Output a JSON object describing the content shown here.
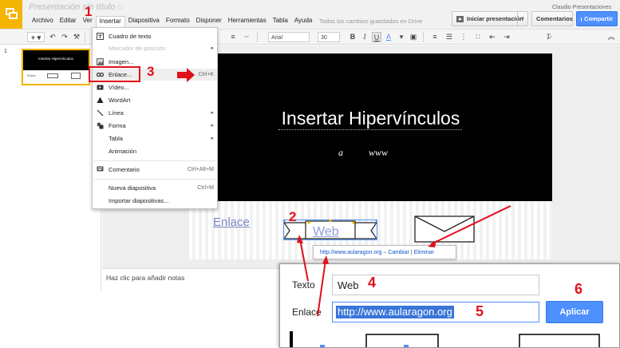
{
  "header": {
    "doc_title": "Presentación sin título",
    "user": "Claudio Presentaciones",
    "save_status": "Todos los cambios guardados en Drive",
    "present_label": "Iniciar presentación",
    "comments_label": "Comentarios",
    "share_label": "Compartir"
  },
  "menubar": [
    "Archivo",
    "Editar",
    "Ver",
    "Insertar",
    "Diapositiva",
    "Formato",
    "Disponer",
    "Herramientas",
    "Tabla",
    "Ayuda"
  ],
  "toolbar": {
    "font": "Arial",
    "size": "30",
    "bold": "B",
    "italic": "I",
    "underline": "U",
    "textcolor": "A"
  },
  "insert_menu": [
    {
      "label": "Cuadro de texto",
      "shortcut": "",
      "icon": "textbox-icon"
    },
    {
      "label": "Marcador de posición",
      "shortcut": "",
      "icon": ""
    },
    {
      "label": "Imagen...",
      "shortcut": "",
      "icon": "image-icon"
    },
    {
      "label": "Enlace...",
      "shortcut": "Ctrl+K",
      "icon": "link-icon"
    },
    {
      "label": "Vídeo...",
      "shortcut": "",
      "icon": "video-icon"
    },
    {
      "label": "WordArt",
      "shortcut": "",
      "icon": "wordart-icon"
    },
    {
      "label": "Línea",
      "shortcut": "",
      "icon": "line-icon"
    },
    {
      "label": "Forma",
      "shortcut": "",
      "icon": "shape-icon"
    },
    {
      "label": "Tabla",
      "shortcut": "",
      "icon": ""
    },
    {
      "label": "Animación",
      "shortcut": "",
      "icon": ""
    },
    {
      "label": "Comentario",
      "shortcut": "Ctrl+Alt+M",
      "icon": "comment-icon"
    },
    {
      "label": "Nueva diapositiva",
      "shortcut": "Ctrl+M",
      "icon": ""
    },
    {
      "label": "Importar diapositivas...",
      "shortcut": "",
      "icon": ""
    }
  ],
  "filmstrip": {
    "slide_number": "1",
    "thumb_title": "Insertar Hipervínculos"
  },
  "slide": {
    "title": "Insertar Hipervínculos",
    "sub_a": "a",
    "sub_b": "www",
    "link_text": "Enlace",
    "web_text": "Web"
  },
  "notes_placeholder": "Haz clic para añadir notas",
  "link_bubble": {
    "url": "http://www.aularagon.org",
    "separator": "–",
    "change": "Cambiar",
    "divider": "|",
    "remove": "Eliminar"
  },
  "link_dialog": {
    "text_label": "Texto",
    "text_value": "Web",
    "link_label": "Enlace",
    "link_value": "http://www.aularagon.org",
    "apply_label": "Aplicar"
  },
  "annotations": [
    "1",
    "2",
    "3",
    "4",
    "5",
    "6"
  ],
  "colors": {
    "accent": "#4d90fe",
    "annotation": "#e0101a",
    "logo": "#f4b400"
  }
}
